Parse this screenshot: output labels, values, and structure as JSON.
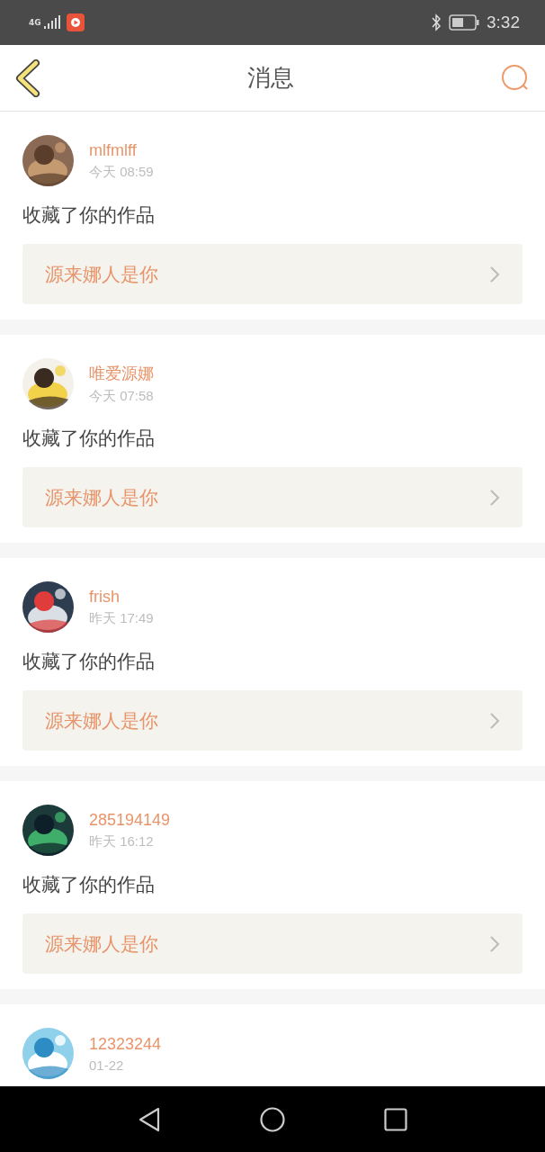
{
  "status_bar": {
    "network": "4G",
    "time": "3:32"
  },
  "header": {
    "title": "消息"
  },
  "messages": [
    {
      "name": "mlfmlff",
      "time": "今天 08:59",
      "action": "收藏了你的作品",
      "work": "源来娜人是你"
    },
    {
      "name": "唯爱源娜",
      "time": "今天 07:58",
      "action": "收藏了你的作品",
      "work": "源来娜人是你"
    },
    {
      "name": "frish",
      "time": "昨天 17:49",
      "action": "收藏了你的作品",
      "work": "源来娜人是你"
    },
    {
      "name": "285194149",
      "time": "昨天 16:12",
      "action": "收藏了你的作品",
      "work": "源来娜人是你"
    },
    {
      "name": "12323244",
      "time": "01-22"
    }
  ]
}
